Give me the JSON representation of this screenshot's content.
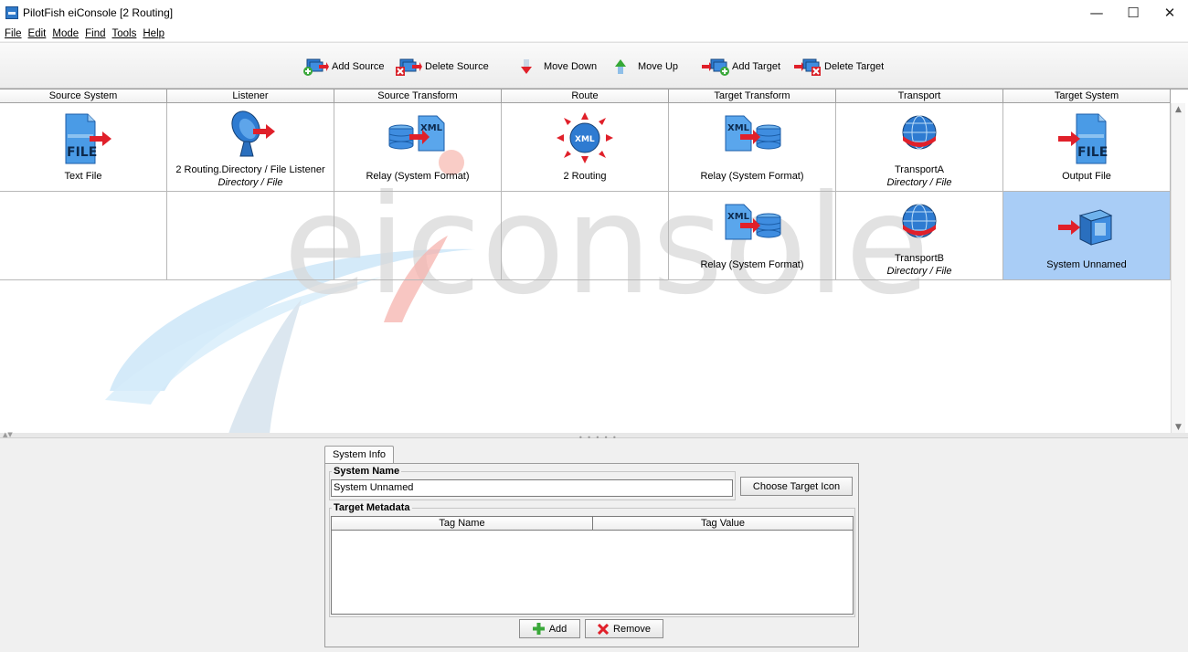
{
  "window": {
    "title": "PilotFish eiConsole [2 Routing]",
    "controls": [
      "—",
      "☐",
      "✕"
    ]
  },
  "menu": [
    "File",
    "Edit",
    "Mode",
    "Find",
    "Tools",
    "Help"
  ],
  "toolbar": {
    "add_source": "Add Source",
    "delete_source": "Delete Source",
    "move_down": "Move Down",
    "move_up": "Move Up",
    "add_target": "Add Target",
    "delete_target": "Delete Target"
  },
  "grid": {
    "columns": [
      "Source System",
      "Listener",
      "Source Transform",
      "Route",
      "Target Transform",
      "Transport",
      "Target System"
    ],
    "row1": {
      "source_system": {
        "label": "Text File",
        "icon": "file-icon"
      },
      "listener": {
        "label": "2 Routing.Directory / File Listener",
        "sub": "Directory / File",
        "icon": "satellite-dish-icon"
      },
      "source_transform": {
        "label": "Relay (System Format)",
        "icon": "xml-database-icon"
      },
      "route": {
        "label": "2 Routing",
        "icon": "xml-route-icon"
      },
      "target_transform": {
        "label": "Relay (System Format)",
        "icon": "xml-database-icon"
      },
      "transport": {
        "label": "TransportA",
        "sub": "Directory / File",
        "icon": "globe-icon"
      },
      "target_system": {
        "label": "Output File",
        "icon": "file-icon"
      }
    },
    "row2": {
      "target_transform": {
        "label": "Relay (System Format)",
        "icon": "xml-database-icon"
      },
      "transport": {
        "label": "TransportB",
        "sub": "Directory / File",
        "icon": "globe-icon"
      },
      "target_system": {
        "label": "System Unnamed",
        "icon": "system-box-icon"
      }
    }
  },
  "watermark": {
    "text": "eiconsole"
  },
  "panel": {
    "tab_label": "System Info",
    "system_name_legend": "System Name",
    "system_name_value": "System Unnamed",
    "choose_icon_button": "Choose Target Icon",
    "metadata_legend": "Target Metadata",
    "metadata_columns": [
      "Tag Name",
      "Tag Value"
    ],
    "add_button": "Add",
    "remove_button": "Remove"
  },
  "colors": {
    "selection": "#a0c8f5",
    "arrow_red": "#e0202a",
    "icon_blue": "#2e7bd1"
  }
}
